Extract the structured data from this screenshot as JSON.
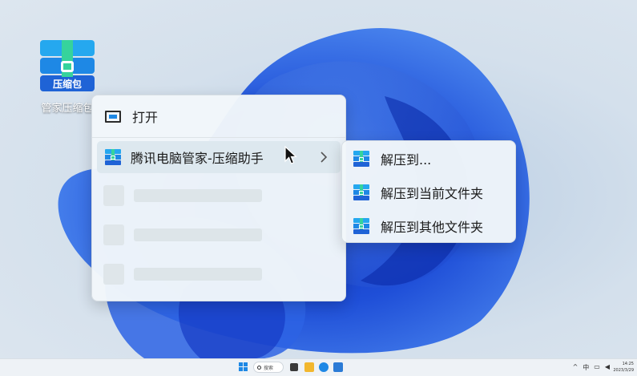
{
  "desktop_icon": {
    "logo_text": "压缩包",
    "label": "管家压缩包"
  },
  "context_menu": {
    "open_label": "打开",
    "tencent_label": "腾讯电脑管家-压缩助手"
  },
  "submenu": {
    "items": [
      {
        "label": "解压到..."
      },
      {
        "label": "解压到当前文件夹"
      },
      {
        "label": "解压到其他文件夹"
      }
    ]
  },
  "taskbar": {
    "search_label": "搜索",
    "clock_time": "14:25",
    "clock_date": "2023/3/29"
  },
  "colors": {
    "accent": "#1e88e5",
    "logo_green": "#36d39c",
    "wallpaper_blue": "#1f4fd8"
  },
  "icons": [
    "open-window-icon",
    "compress-app-icon",
    "chevron-right-icon",
    "mouse-cursor-icon",
    "windows-start-icon",
    "search-icon"
  ]
}
